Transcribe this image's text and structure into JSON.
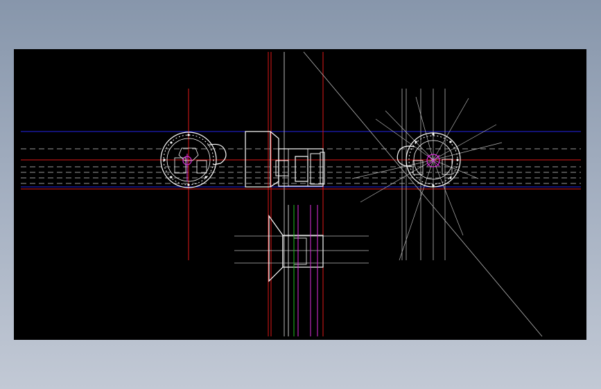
{
  "window": {
    "background_top": "#8796ab",
    "background_bottom": "#c2c9d5"
  },
  "viewport": {
    "background": "#000000"
  },
  "palette": {
    "geometry": "#ffffff",
    "construction": "#b8b8b8",
    "centerline_red": "#e01818",
    "centerline_blue": "#2424e8",
    "hidden_dash": "#9a9a9a",
    "magenta": "#e030e0",
    "green": "#20c020"
  },
  "drawing": {
    "views": [
      "front-view",
      "side-section-view",
      "top-view",
      "rear-view"
    ],
    "icon": "cad-drawing"
  }
}
